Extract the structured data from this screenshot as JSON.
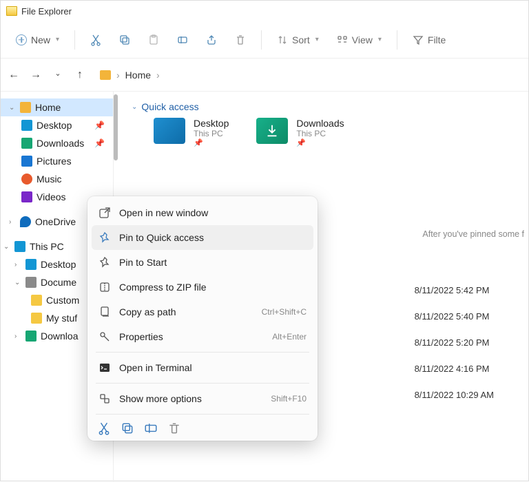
{
  "title": "File Explorer",
  "toolbar": {
    "new": "New",
    "sort": "Sort",
    "view": "View",
    "filter": "Filte"
  },
  "breadcrumb": {
    "home": "Home"
  },
  "sidebar": {
    "home": "Home",
    "desktop": "Desktop",
    "downloads": "Downloads",
    "pictures": "Pictures",
    "music": "Music",
    "videos": "Videos",
    "onedrive": "OneDrive",
    "thispc": "This PC",
    "pc_desktop": "Desktop",
    "pc_documents": "Docume",
    "pc_custom": "Custom",
    "pc_mystuff": "My stuf",
    "pc_downloads": "Downloa"
  },
  "quick": {
    "section": "Quick access",
    "desktop": {
      "name": "Desktop",
      "sub": "This PC"
    },
    "downloads": {
      "name": "Downloads",
      "sub": "This PC"
    }
  },
  "hint": "After you've pinned some f",
  "dates": {
    "d1": "8/11/2022 5:42 PM",
    "d2": "8/11/2022 5:40 PM",
    "d3": "8/11/2022 5:20 PM",
    "d4": "8/11/2022 4:16 PM",
    "d5": "8/11/2022 10:29 AM"
  },
  "context_menu": {
    "open_new_window": "Open in new window",
    "pin_quick": "Pin to Quick access",
    "pin_start": "Pin to Start",
    "compress_zip": "Compress to ZIP file",
    "copy_path": "Copy as path",
    "copy_path_sc": "Ctrl+Shift+C",
    "properties": "Properties",
    "properties_sc": "Alt+Enter",
    "open_terminal": "Open in Terminal",
    "show_more": "Show more options",
    "show_more_sc": "Shift+F10"
  }
}
